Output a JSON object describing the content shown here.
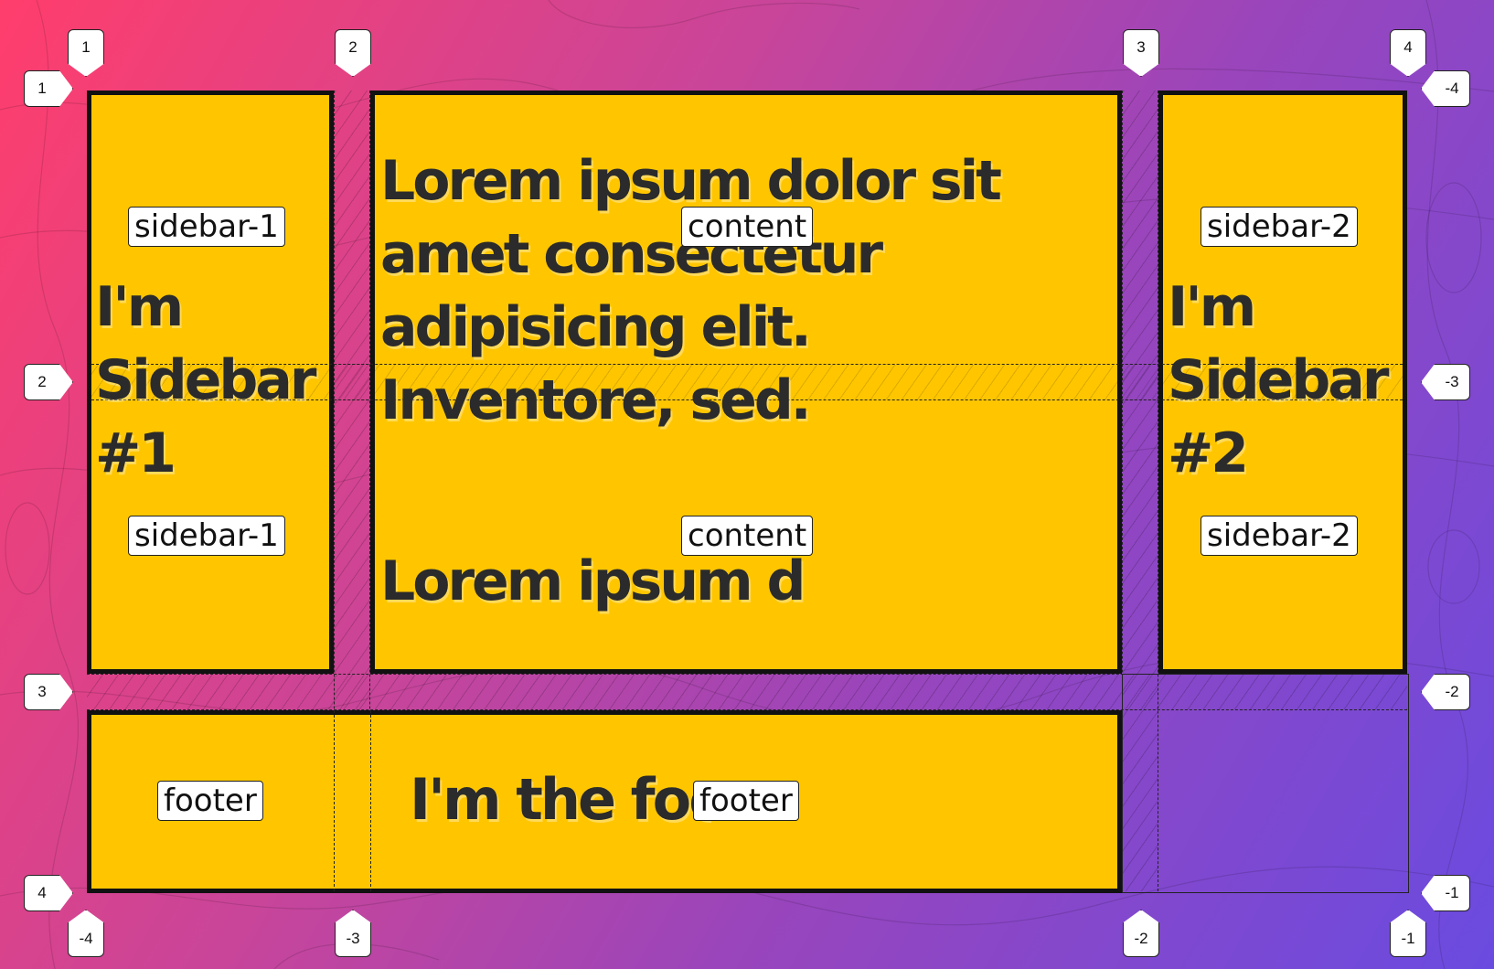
{
  "colors": {
    "area_fill": "#ffc600",
    "area_border": "#111111",
    "text": "#2b2b2b",
    "bg_start": "#ff3e6c",
    "bg_end": "#6a4be0"
  },
  "areas": {
    "sidebar1": {
      "label": "sidebar-1",
      "text": "I'm Sidebar #1"
    },
    "content": {
      "label": "content",
      "text": "Lorem ipsum dolor sit amet consectetur adipisicing elit. Inventore, sed.",
      "text2": "Lorem ipsum d"
    },
    "sidebar2": {
      "label": "sidebar-2",
      "text": "I'm Sidebar #2"
    },
    "footer": {
      "label": "footer",
      "text": "I'm the footer"
    }
  },
  "grid_markers": {
    "top": [
      "1",
      "2",
      "3",
      "4"
    ],
    "bottom": [
      "-4",
      "-3",
      "-2",
      "-1"
    ],
    "left": [
      "1",
      "2",
      "3",
      "4"
    ],
    "right": [
      "-4",
      "-3",
      "-2",
      "-1"
    ]
  }
}
